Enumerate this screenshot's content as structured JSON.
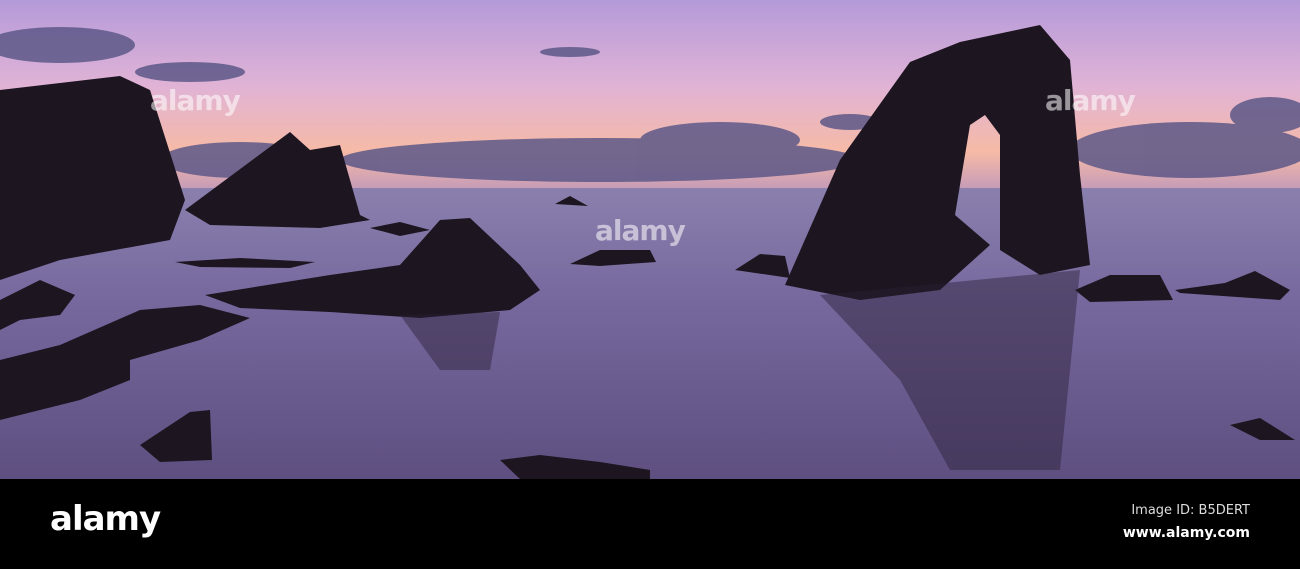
{
  "footer": {
    "logo": "alamy",
    "image_id": "Image ID: B5DERT",
    "url": "www.alamy.com"
  },
  "watermark": "alamy",
  "colors": {
    "sky_top": "#b89ad8",
    "sky_horizon": "#f3b7a8",
    "sea": "#6f5f93",
    "rock": "#1d1520"
  }
}
